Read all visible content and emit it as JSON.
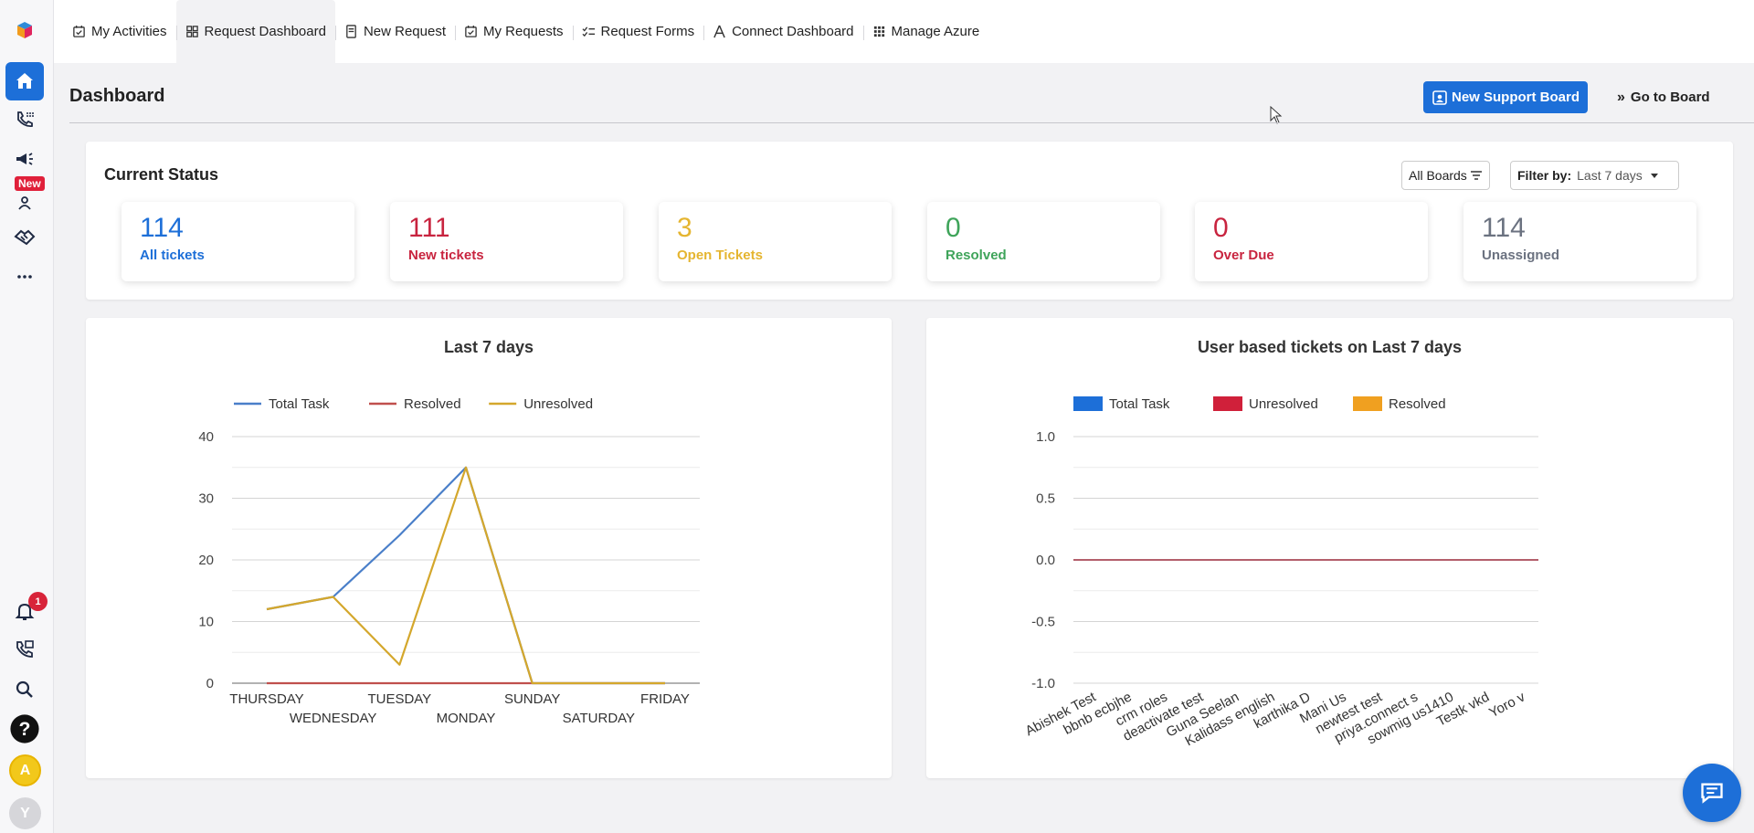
{
  "nav": {
    "tabs": [
      {
        "label": "My Activities",
        "icon": "activities-icon"
      },
      {
        "label": "Request Dashboard",
        "icon": "dashboard-icon"
      },
      {
        "label": "New Request",
        "icon": "new-request-icon"
      },
      {
        "label": "My Requests",
        "icon": "requests-icon"
      },
      {
        "label": "Request Forms",
        "icon": "forms-icon"
      },
      {
        "label": "Connect Dashboard",
        "icon": "connect-icon"
      },
      {
        "label": "Manage Azure",
        "icon": "grid-icon"
      }
    ],
    "active_tab": "Request Dashboard"
  },
  "sidebar": {
    "new_badge": "New",
    "notification_count": "1",
    "avatar_a": "A",
    "avatar_y": "Y"
  },
  "header": {
    "title": "Dashboard",
    "new_board_label": "New Support Board",
    "go_to_board_label": "Go to Board"
  },
  "status": {
    "title": "Current Status",
    "boards_filter": "All Boards",
    "filter_label": "Filter by:",
    "filter_value": "Last 7 days",
    "stats": [
      {
        "value": "114",
        "label": "All tickets",
        "color": "#1d6fd8"
      },
      {
        "value": "111",
        "label": "New tickets",
        "color": "#c8243f"
      },
      {
        "value": "3",
        "label": "Open Tickets",
        "color": "#e5b530"
      },
      {
        "value": "0",
        "label": "Resolved",
        "color": "#3fa45a"
      },
      {
        "value": "0",
        "label": "Over Due",
        "color": "#c8243f"
      },
      {
        "value": "114",
        "label": "Unassigned",
        "color": "#6b7280"
      }
    ]
  },
  "chart_data": [
    {
      "type": "line",
      "title": "Last 7 days",
      "categories": [
        "THURSDAY",
        "WEDNESDAY",
        "TUESDAY",
        "MONDAY",
        "SUNDAY",
        "SATURDAY",
        "FRIDAY"
      ],
      "series": [
        {
          "name": "Total Task",
          "color": "#4a7fc9",
          "values": [
            12,
            14,
            24,
            35,
            0,
            0,
            0
          ]
        },
        {
          "name": "Resolved",
          "color": "#c0504d",
          "values": [
            0,
            0,
            0,
            0,
            0,
            0,
            0
          ]
        },
        {
          "name": "Unresolved",
          "color": "#d4a72c",
          "values": [
            12,
            14,
            3,
            35,
            0,
            0,
            0
          ]
        }
      ],
      "ylim": [
        0,
        40
      ],
      "yticks": [
        0,
        10,
        20,
        30,
        40
      ],
      "legend": "top",
      "grid": true
    },
    {
      "type": "bar",
      "title": "User based tickets on Last 7 days",
      "categories": [
        "Abishek Test",
        "bbnb ecbjhe",
        "crm roles",
        "deactivate test",
        "Guna Seelan",
        "Kalidass english",
        "karthika D",
        "Mani Us",
        "newtest test",
        "priya.connect s",
        "sowmig us1410",
        "Testk vkd",
        "Yoro v"
      ],
      "series": [
        {
          "name": "Total Task",
          "color": "#1d6fd8",
          "values": [
            0,
            0,
            0,
            0,
            0,
            0,
            0,
            0,
            0,
            0,
            0,
            0,
            0
          ]
        },
        {
          "name": "Unresolved",
          "color": "#d0203a",
          "values": [
            0,
            0,
            0,
            0,
            0,
            0,
            0,
            0,
            0,
            0,
            0,
            0,
            0
          ]
        },
        {
          "name": "Resolved",
          "color": "#f0a020",
          "values": [
            0,
            0,
            0,
            0,
            0,
            0,
            0,
            0,
            0,
            0,
            0,
            0,
            0
          ]
        }
      ],
      "ylim": [
        -1.0,
        1.0
      ],
      "yticks": [
        "-1.0",
        "-0.5",
        "0.0",
        "0.5",
        "1.0"
      ],
      "legend": "top",
      "grid": true
    }
  ]
}
